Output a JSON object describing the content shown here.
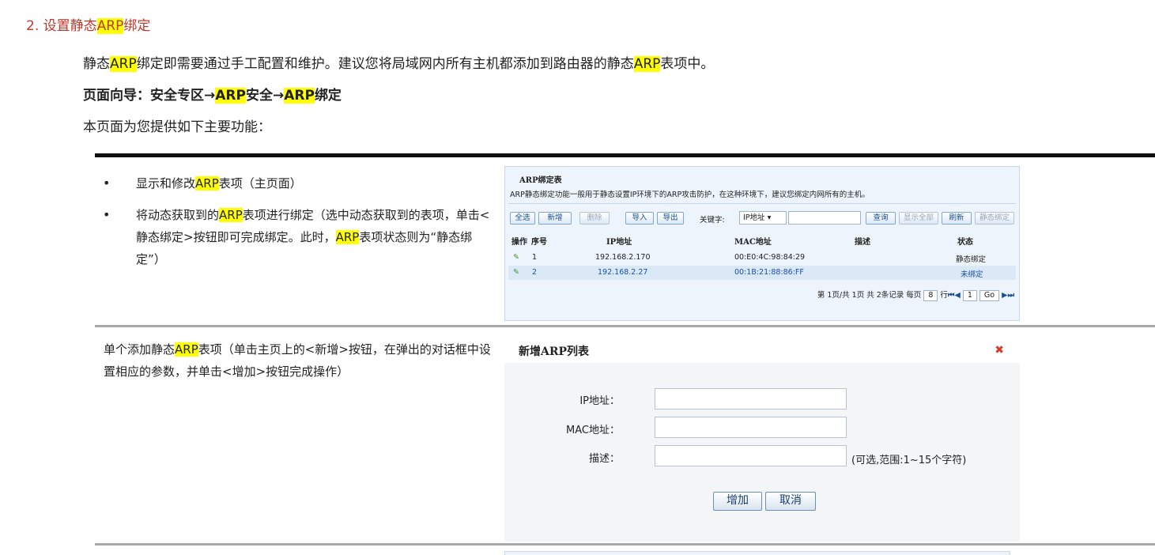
{
  "section": {
    "number": "2.",
    "title_pre": "设置静态",
    "title_hl": "ARP",
    "title_post": "绑定"
  },
  "intro": {
    "line1_a": "静态",
    "line1_hl": "ARP",
    "line1_b": "绑定即需要通过手工配置和维护。建议您将局域网内所有主机都添加到路由器的静态",
    "line1_hl2": "ARP",
    "line1_c": "表项中。",
    "line2_a": "页面向导：安全专区→",
    "line2_hl": "ARP",
    "line2_b": "安全→",
    "line2_hl2": "ARP",
    "line2_c": "绑定",
    "line3": "本页面为您提供如下主要功能："
  },
  "bullets": [
    {
      "a": "显示和修改",
      "hl": "ARP",
      "b": "表项（主页面）"
    },
    {
      "a": "将动态获取到的",
      "hl": "ARP",
      "b": "表项进行绑定（选中动态获取到的表项，单击<静态绑定>按钮即可完成绑定。此时，",
      "hl2": "ARP",
      "c": "表项状态则为“静态绑定”）"
    }
  ],
  "add_desc": {
    "a": "单个添加静态",
    "hl": "ARP",
    "b": "表项（单击主页上的<新增>按钮，在弹出的对话框中设置相应的参数，并单击<增加>按钮完成操作）"
  },
  "arp_table": {
    "title": "ARP绑定表",
    "description": "ARP静态绑定功能一般用于静态设置IP环境下的ARP攻击防护，在这种环境下，建议您绑定内网所有的主机。",
    "buttons": {
      "select_all": "全选",
      "add": "新增",
      "delete": "删除",
      "import": "导入",
      "export": "导出",
      "query": "查询",
      "show_all": "显示全部",
      "refresh": "刷新",
      "static_bind": "静态绑定"
    },
    "keyword_label": "关键字:",
    "keyword_select": "IP地址",
    "headers": {
      "op": "操作",
      "seq": "序号",
      "ip": "IP地址",
      "mac": "MAC地址",
      "desc": "描述",
      "status": "状态"
    },
    "rows": [
      {
        "seq": "1",
        "ip": "192.168.2.170",
        "mac": "00:E0:4C:98:84:29",
        "desc": "",
        "status": "静态绑定"
      },
      {
        "seq": "2",
        "ip": "192.168.2.27",
        "mac": "00:1B:21:88:86:FF",
        "desc": "",
        "status": "未绑定"
      }
    ],
    "pager": {
      "text": "第 1页/共 1页 共 2条记录 每页",
      "per_page": "8",
      "rows_label": "行",
      "page": "1",
      "go": "Go"
    }
  },
  "dialog": {
    "title": "新增ARP列表",
    "ip_label": "IP地址：",
    "mac_label": "MAC地址：",
    "desc_label": "描述：",
    "desc_hint": "(可选,范围:1~15个字符)",
    "add_button": "增加",
    "cancel_button": "取消"
  }
}
